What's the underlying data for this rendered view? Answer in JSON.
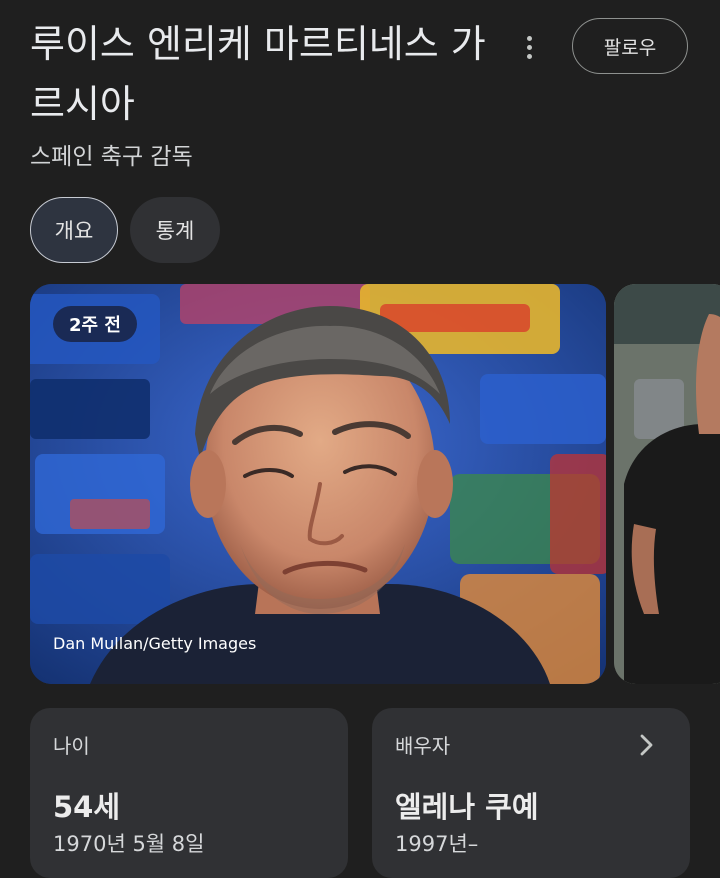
{
  "header": {
    "title": "루이스 엔리케 마르티네스 가르시아",
    "follow_label": "팔로우",
    "subtitle": "스페인 축구 감독"
  },
  "tabs": [
    {
      "label": "개요",
      "selected": true
    },
    {
      "label": "통계",
      "selected": false
    }
  ],
  "media": {
    "time_badge": "2주 전",
    "credit": "Dan Mullan/Getty Images"
  },
  "cards": {
    "age": {
      "label": "나이",
      "value": "54세",
      "sub": "1970년 5월 8일"
    },
    "spouse": {
      "label": "배우자",
      "value": "엘레나 쿠예",
      "sub": "1997년–"
    }
  },
  "icons": {
    "more": "more-vert-icon",
    "chevron": "chevron-right-icon"
  },
  "colors": {
    "background": "#1f1f1f",
    "card": "#303134",
    "tab_selected_bg": "#2e3440",
    "badge_bg": "#1a2a55"
  }
}
